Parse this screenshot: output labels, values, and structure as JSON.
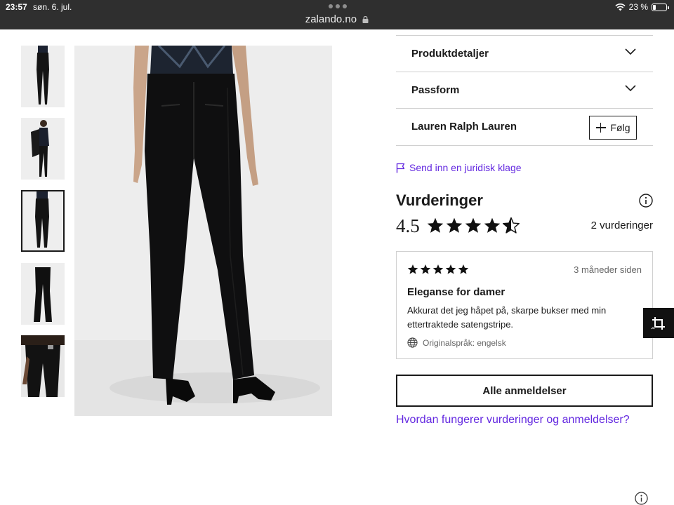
{
  "status_bar": {
    "time": "23:57",
    "date": "søn. 6. jul.",
    "url": "zalando.no",
    "battery": "23 %"
  },
  "gallery": {
    "thumbnails": [
      {
        "name": "thumbnail-1",
        "active": false
      },
      {
        "name": "thumbnail-2",
        "active": false
      },
      {
        "name": "thumbnail-3",
        "active": true
      },
      {
        "name": "thumbnail-4",
        "active": false
      },
      {
        "name": "thumbnail-5",
        "active": false
      }
    ]
  },
  "details": {
    "product_details_label": "Produktdetaljer",
    "fit_label": "Passform",
    "brand_name": "Lauren Ralph Lauren",
    "follow_label": "Følg"
  },
  "legal_complaint": "Send inn en juridisk klage",
  "ratings": {
    "title": "Vurderinger",
    "average": "4.5",
    "stars_value": 4.5,
    "count_label": "2 vurderinger"
  },
  "review": {
    "stars_value": 5,
    "date": "3 måneder siden",
    "title": "Eleganse for damer",
    "text": "Akkurat det jeg håpet på, skarpe bukser med min ettertraktede satengstripe.",
    "original_language": "Originalspråk: engelsk"
  },
  "all_reviews_label": "Alle anmeldelser",
  "how_ratings_work_label": "Hvordan fungerer vurderinger og anmeldelser?",
  "colors": {
    "accent_purple": "#6328e0",
    "text": "#1a1a1a",
    "status_bar": "#2f2f2f"
  }
}
